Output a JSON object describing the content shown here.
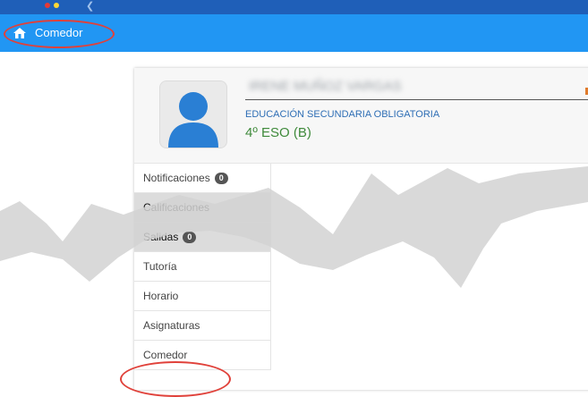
{
  "appbar": {
    "title": "Comedor",
    "home_icon": "home-icon",
    "colors": {
      "bar": "#2196f3",
      "top_strip": "#1f5fb8"
    }
  },
  "profile": {
    "student_name": "IRENE MUÑOZ VARGAS",
    "stage": "EDUCACIÓN SECUNDARIA OBLIGATORIA",
    "course": "4º ESO (B)",
    "avatar_icon": "user-avatar-icon"
  },
  "menu": {
    "items": [
      {
        "label": "Notificaciones",
        "badge": "0"
      },
      {
        "label": "Calificaciones"
      },
      {
        "label": "Salidas",
        "badge": "0"
      },
      {
        "label": "Tutoría"
      },
      {
        "label": "Horario"
      },
      {
        "label": "Asignaturas"
      },
      {
        "label": "Comedor"
      }
    ]
  },
  "annotations": {
    "color": "#e0413a"
  }
}
